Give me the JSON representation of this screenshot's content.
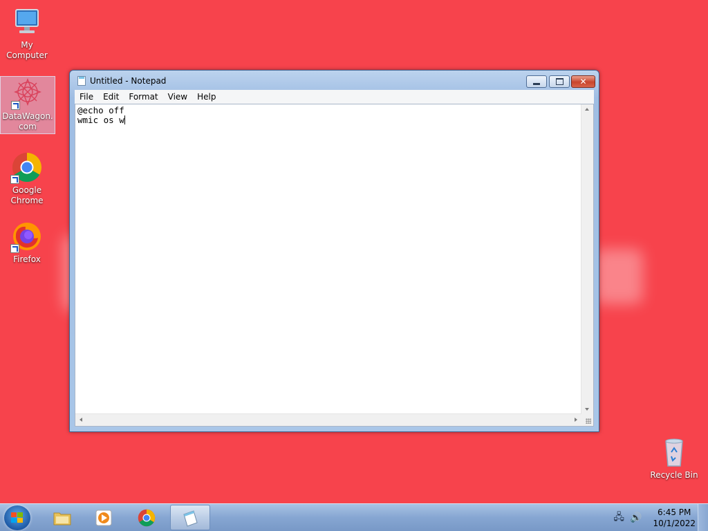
{
  "desktop": {
    "background_color": "#f7434c",
    "icons": [
      {
        "label": "My Computer",
        "icon": "computer-icon"
      },
      {
        "label": "DataWagon.com",
        "icon": "datawagon-logo-icon"
      },
      {
        "label": "Google Chrome",
        "icon": "chrome-icon"
      },
      {
        "label": "Firefox",
        "icon": "firefox-icon"
      },
      {
        "label": "Recycle Bin",
        "icon": "recycle-bin-icon"
      }
    ]
  },
  "notepad": {
    "title": "Untitled - Notepad",
    "menu": [
      "File",
      "Edit",
      "Format",
      "View",
      "Help"
    ],
    "content_lines": [
      "@echo off",
      "wmic os w"
    ]
  },
  "taskbar": {
    "pinned": [
      {
        "name": "explorer",
        "icon": "folder-icon"
      },
      {
        "name": "media-player",
        "icon": "media-player-icon"
      },
      {
        "name": "chrome",
        "icon": "chrome-icon"
      },
      {
        "name": "notepad",
        "icon": "notepad-icon",
        "active": true
      }
    ],
    "clock": {
      "time": "6:45 PM",
      "date": "10/1/2022"
    }
  }
}
